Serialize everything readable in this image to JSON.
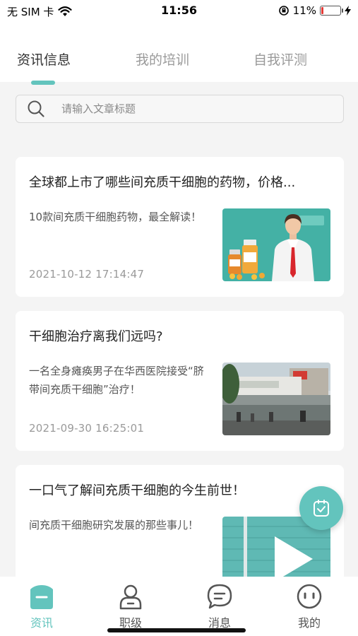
{
  "status_bar": {
    "carrier": "无 SIM 卡",
    "time": "11:56",
    "battery_percent": "11%",
    "battery_level": 0.11,
    "battery_color": "#e53935"
  },
  "top_tabs": [
    {
      "label": "资讯信息",
      "active": true
    },
    {
      "label": "我的培训",
      "active": false
    },
    {
      "label": "自我评测",
      "active": false
    }
  ],
  "search": {
    "placeholder": "请输入文章标题",
    "value": "",
    "icon": "search-icon"
  },
  "articles": [
    {
      "title": "全球都上市了哪些间充质干细胞的药物，价格...",
      "summary": "10款间充质干细胞药物，最全解读！",
      "date": "2021-10-12 17:14:47",
      "thumb": "doctor-with-medicine-bottles"
    },
    {
      "title": "干细胞治疗离我们远吗?",
      "summary": "一名全身瘫痪男子在华西医院接受“脐带间充质干细胞”治疗！",
      "date": "2021-09-30 16:25:01",
      "thumb": "hospital-building-photo"
    },
    {
      "title": "一口气了解间充质干细胞的今生前世！",
      "summary": "间充质干细胞研究发展的那些事儿！",
      "date": "",
      "thumb": "teal-brick-wall-arrow"
    }
  ],
  "fab": {
    "icon": "checklist-icon"
  },
  "bottom_nav": [
    {
      "label": "资讯",
      "icon": "news-icon",
      "active": true
    },
    {
      "label": "职级",
      "icon": "user-level-icon",
      "active": false
    },
    {
      "label": "消息",
      "icon": "message-icon",
      "active": false
    },
    {
      "label": "我的",
      "icon": "profile-face-icon",
      "active": false
    }
  ],
  "colors": {
    "accent": "#63c4bd",
    "background": "#f4f4f4",
    "text_primary": "#222222",
    "text_muted": "#9a9a9a"
  }
}
